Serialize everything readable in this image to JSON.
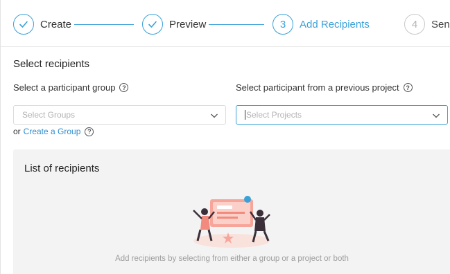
{
  "stepper": {
    "steps": [
      {
        "label": "Create",
        "marker": "check-icon",
        "state": "done"
      },
      {
        "label": "Preview",
        "marker": "check-icon",
        "state": "done"
      },
      {
        "label": "Add Recipients",
        "number": "3",
        "state": "active"
      },
      {
        "label": "Send",
        "number": "4",
        "state": "pending"
      }
    ],
    "accent_color": "#3aa1d8"
  },
  "section": {
    "title": "Select recipients"
  },
  "group_field": {
    "label": "Select a participant group",
    "placeholder": "Select Groups"
  },
  "project_field": {
    "label": "Select participant from a previous project",
    "placeholder": "Select Projects"
  },
  "create_group": {
    "prefix": "or",
    "link_label": "Create a Group"
  },
  "recipients_panel": {
    "title": "List of recipients",
    "empty_message": "Add recipients by selecting from either a group or a project or both"
  }
}
